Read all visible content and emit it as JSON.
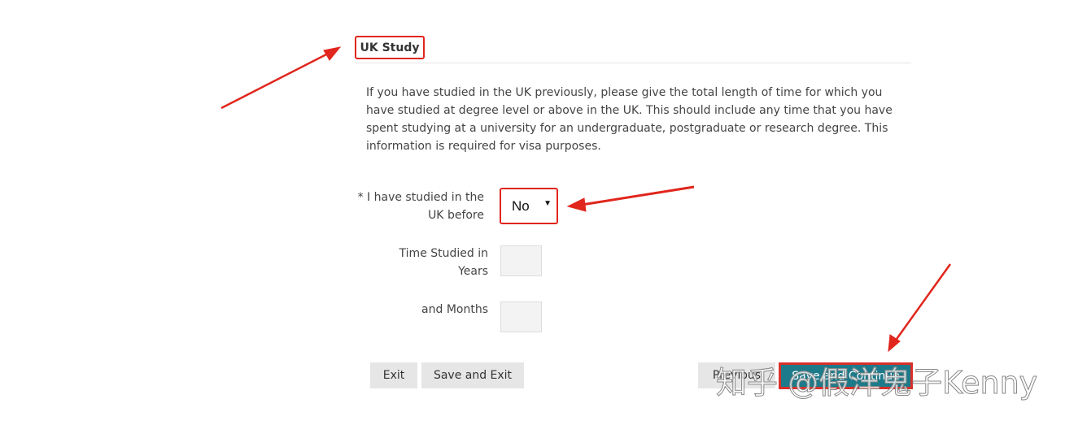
{
  "section": {
    "title": "UK Study",
    "intro": "If you have studied in the UK previously, please give the total length of time for which you have studied at degree level or above in the UK. This should include any time that you have spent studying at a university for an undergraduate, postgraduate or research degree. This information is required for visa purposes."
  },
  "form": {
    "studied_label": "*  I have studied in the UK before",
    "studied_value": "No",
    "years_label": "Time Studied in Years",
    "years_value": "",
    "months_label": "and Months",
    "months_value": ""
  },
  "buttons": {
    "exit": "Exit",
    "save_exit": "Save and Exit",
    "previous": "Previous",
    "save_continue": "Save and Continue"
  },
  "watermark": "知乎 @假洋鬼子Kenny",
  "colors": {
    "accent": "#1d7a8a",
    "annotation": "#e0261d"
  }
}
